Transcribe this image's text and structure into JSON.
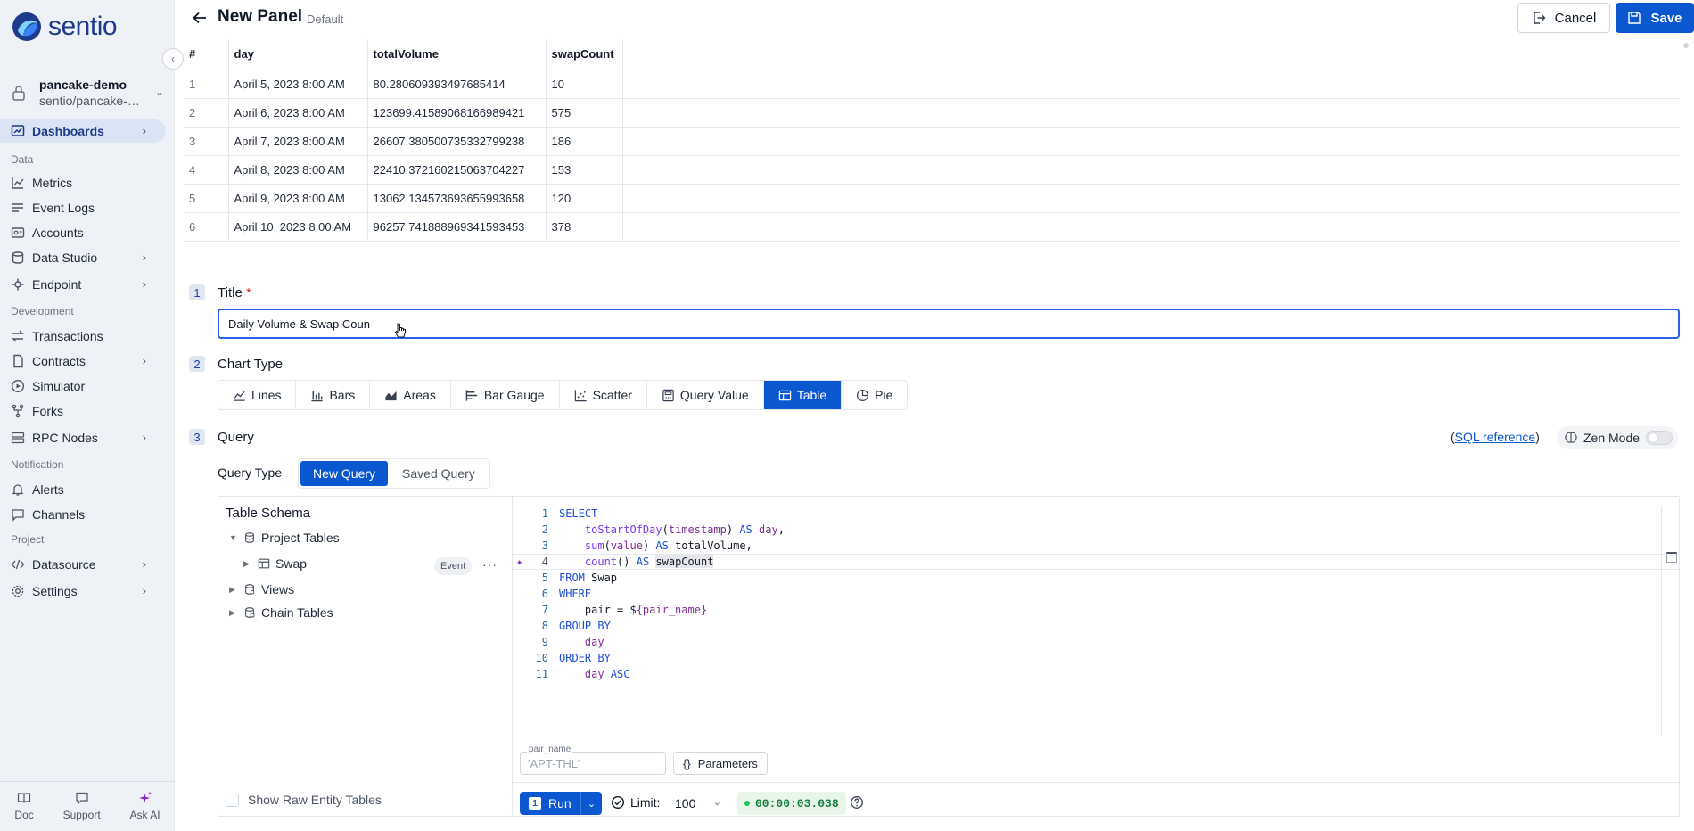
{
  "brand": {
    "name": "sentio",
    "accent": "#0b57d0"
  },
  "project": {
    "name": "pancake-demo",
    "path": "sentio/pancake-demo"
  },
  "sidebar": {
    "dashboards": "Dashboards",
    "sections": {
      "data": "Data",
      "development": "Development",
      "notification": "Notification",
      "project": "Project"
    },
    "items": {
      "metrics": "Metrics",
      "event_logs": "Event Logs",
      "accounts": "Accounts",
      "data_studio": "Data Studio",
      "endpoint": "Endpoint",
      "transactions": "Transactions",
      "contracts": "Contracts",
      "simulator": "Simulator",
      "forks": "Forks",
      "rpc_nodes": "RPC Nodes",
      "alerts": "Alerts",
      "channels": "Channels",
      "datasource": "Datasource",
      "settings": "Settings"
    },
    "bottom": {
      "doc": "Doc",
      "support": "Support",
      "ask_ai": "Ask AI"
    }
  },
  "header": {
    "title": "New Panel",
    "subtitle": "Default",
    "cancel": "Cancel",
    "save": "Save"
  },
  "result_table": {
    "columns": [
      "#",
      "day",
      "totalVolume",
      "swapCount"
    ],
    "rows": [
      [
        "1",
        "April 5, 2023 8:00 AM",
        "80.280609393497685414",
        "10"
      ],
      [
        "2",
        "April 6, 2023 8:00 AM",
        "123699.41589068166989421",
        "575"
      ],
      [
        "3",
        "April 7, 2023 8:00 AM",
        "26607.380500735332799238",
        "186"
      ],
      [
        "4",
        "April 8, 2023 8:00 AM",
        "22410.372160215063704227",
        "153"
      ],
      [
        "5",
        "April 9, 2023 8:00 AM",
        "13062.134573693655993658",
        "120"
      ],
      [
        "6",
        "April 10, 2023 8:00 AM",
        "96257.741888969341593453",
        "378"
      ]
    ]
  },
  "form": {
    "step1": {
      "num": "1",
      "label": "Title",
      "required": "*",
      "value": "Daily Volume & Swap Coun"
    },
    "step2": {
      "num": "2",
      "label": "Chart Type",
      "types": {
        "lines": "Lines",
        "bars": "Bars",
        "areas": "Areas",
        "bar_gauge": "Bar Gauge",
        "scatter": "Scatter",
        "query_value": "Query Value",
        "table": "Table",
        "pie": "Pie"
      },
      "selected": "Table"
    },
    "step3": {
      "num": "3",
      "label": "Query",
      "sql_ref_open": "(",
      "sql_ref": "SQL reference",
      "sql_ref_close": ")",
      "zen_mode": "Zen Mode",
      "query_type_label": "Query Type",
      "query_types": {
        "new": "New Query",
        "saved": "Saved Query"
      }
    }
  },
  "schema": {
    "title": "Table Schema",
    "project_tables": "Project Tables",
    "swap": "Swap",
    "swap_badge": "Event",
    "more": "···",
    "views": "Views",
    "chain_tables": "Chain Tables",
    "show_raw": "Show Raw Entity Tables"
  },
  "code": {
    "line_numbers": [
      "1",
      "2",
      "3",
      "4",
      "5",
      "6",
      "7",
      "8",
      "9",
      "10",
      "11"
    ]
  },
  "params": {
    "label": "pair_name",
    "value": "'APT-THL'",
    "button": "Parameters"
  },
  "run": {
    "shortcut": "1",
    "label": "Run",
    "limit_label": "Limit:",
    "limit_value": "100",
    "elapsed": "00:00:03.038"
  }
}
